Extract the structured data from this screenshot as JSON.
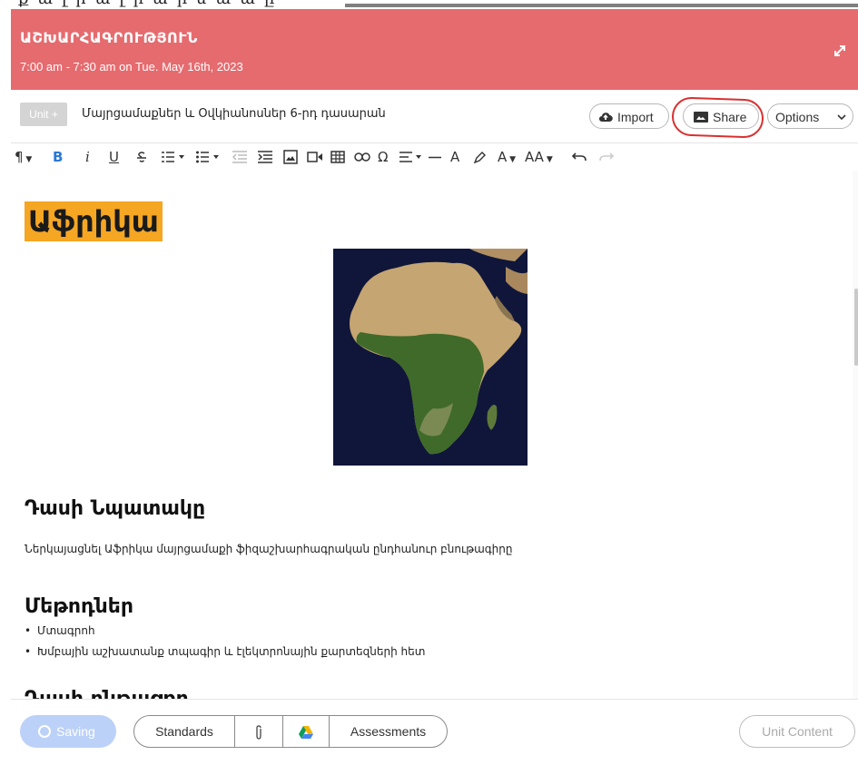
{
  "header": {
    "title": "ԱՇԽԱՐՀԱԳՐՈՒԹՅՈՒՆ",
    "time": "7:00 am - 7:30 am on Tue. May 16th, 2023"
  },
  "unitbar": {
    "unit_button": "Unit +",
    "unit_name": "Մայրցամաքներ և Օվկիանոսներ 6-րդ դասարան",
    "import_label": "Import",
    "share_label": "Share",
    "options_label": "Options"
  },
  "toolbar": {
    "bold": "B",
    "italic": "i",
    "underline": "U",
    "special_char": "Ω",
    "font_color": "A",
    "font_size": "AA"
  },
  "content": {
    "heading": "Աֆրիկա",
    "goal_heading": "Դասի Նպատակը",
    "goal_text": "Ներկայացնել Աֆրիկա մայրցամաքի ֆիզաշխարհագրական ընդհանուր բնութագիրը",
    "methods_heading": "Մեթոդներ",
    "methods": [
      "Մտագրոհ",
      "Խմբային աշխատանք տպագիր և էլեկտրոնային քարտեզների հետ"
    ],
    "next_heading": "Դասի ընթացքը"
  },
  "footer": {
    "saving_label": "Saving",
    "standards_label": "Standards",
    "assessments_label": "Assessments",
    "unit_content_label": "Unit Content"
  },
  "colors": {
    "header_bg": "#e56b6f",
    "highlight": "#f5a623",
    "saving_bg": "#bcd1f7",
    "annotation_circle": "#d93030"
  }
}
